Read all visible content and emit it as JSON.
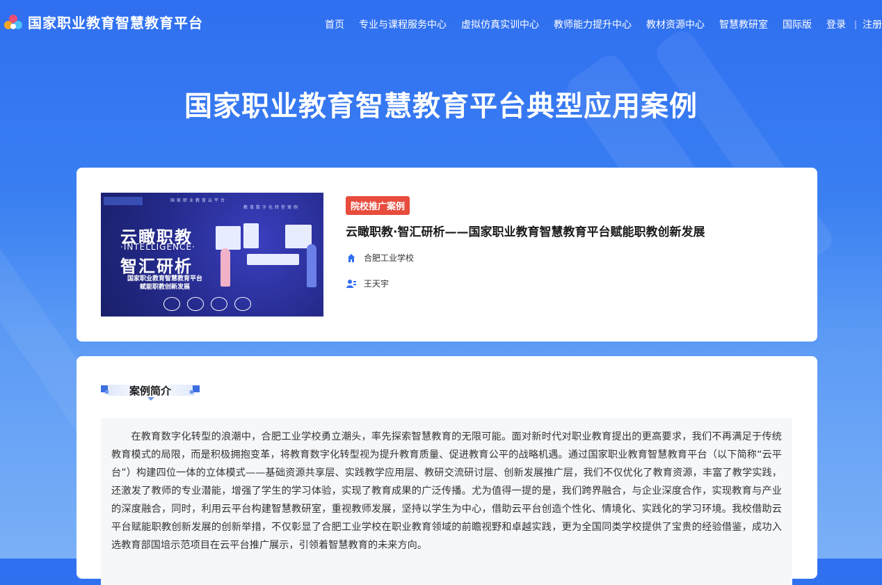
{
  "header": {
    "logo_text": "国家职业教育智慧教育平台",
    "nav": [
      {
        "label": "首页"
      },
      {
        "label": "专业与课程服务中心"
      },
      {
        "label": "虚拟仿真实训中心"
      },
      {
        "label": "教师能力提升中心"
      },
      {
        "label": "教材资源中心"
      },
      {
        "label": "智慧教研室"
      },
      {
        "label": "国际版"
      }
    ],
    "login": "登录",
    "separator": "|",
    "register": "注册"
  },
  "page_title": "国家职业教育智慧教育平台典型应用案例",
  "case": {
    "cover": {
      "top_line1": "国家职业教育云平台",
      "top_line2": "教育数字化转型案例",
      "line1": "云瞰职教",
      "line2": "·INTELLIGENCE·",
      "line3": "智汇研析",
      "line4": "国家职业教育智慧教育平台",
      "line5": "赋能职教创新发展"
    },
    "badge": "院校推广案例",
    "title": "云瞰职教·智汇研析——国家职业教育智慧教育平台赋能职教创新发展",
    "school": "合肥工业学校",
    "author": "王天宇"
  },
  "intro": {
    "heading": "案例简介",
    "text": "在教育数字化转型的浪潮中，合肥工业学校勇立潮头，率先探索智慧教育的无限可能。面对新时代对职业教育提出的更高要求，我们不再满足于传统教育模式的局限，而是积极拥抱变革，将教育数字化转型视为提升教育质量、促进教育公平的战略机遇。通过国家职业教育智慧教育平台（以下简称“云平台”）构建四位一体的立体模式——基础资源共享层、实践教学应用层、教研交流研讨层、创新发展推广层，我们不仅优化了教育资源，丰富了教学实践，还激发了教师的专业潜能，增强了学生的学习体验，实现了教育成果的广泛传播。尤为值得一提的是，我们跨界融合，与企业深度合作，实现教育与产业的深度融合，同时，利用云平台构建智慧教研室，重视教师发展，坚持以学生为中心，借助云平台创造个性化、情境化、实践化的学习环境。我校借助云平台赋能职教创新发展的创新举措，不仅彰显了合肥工业学校在职业教育领域的前瞻视野和卓越实践，更为全国同类学校提供了宝贵的经验借鉴，成功入选教育部国培示范项目在云平台推广展示，引领着智慧教育的未来方向。"
  },
  "colors": {
    "bg_top": "#2f6ff0",
    "badge": "#e74c3c",
    "accent": "#3b6fe0"
  }
}
